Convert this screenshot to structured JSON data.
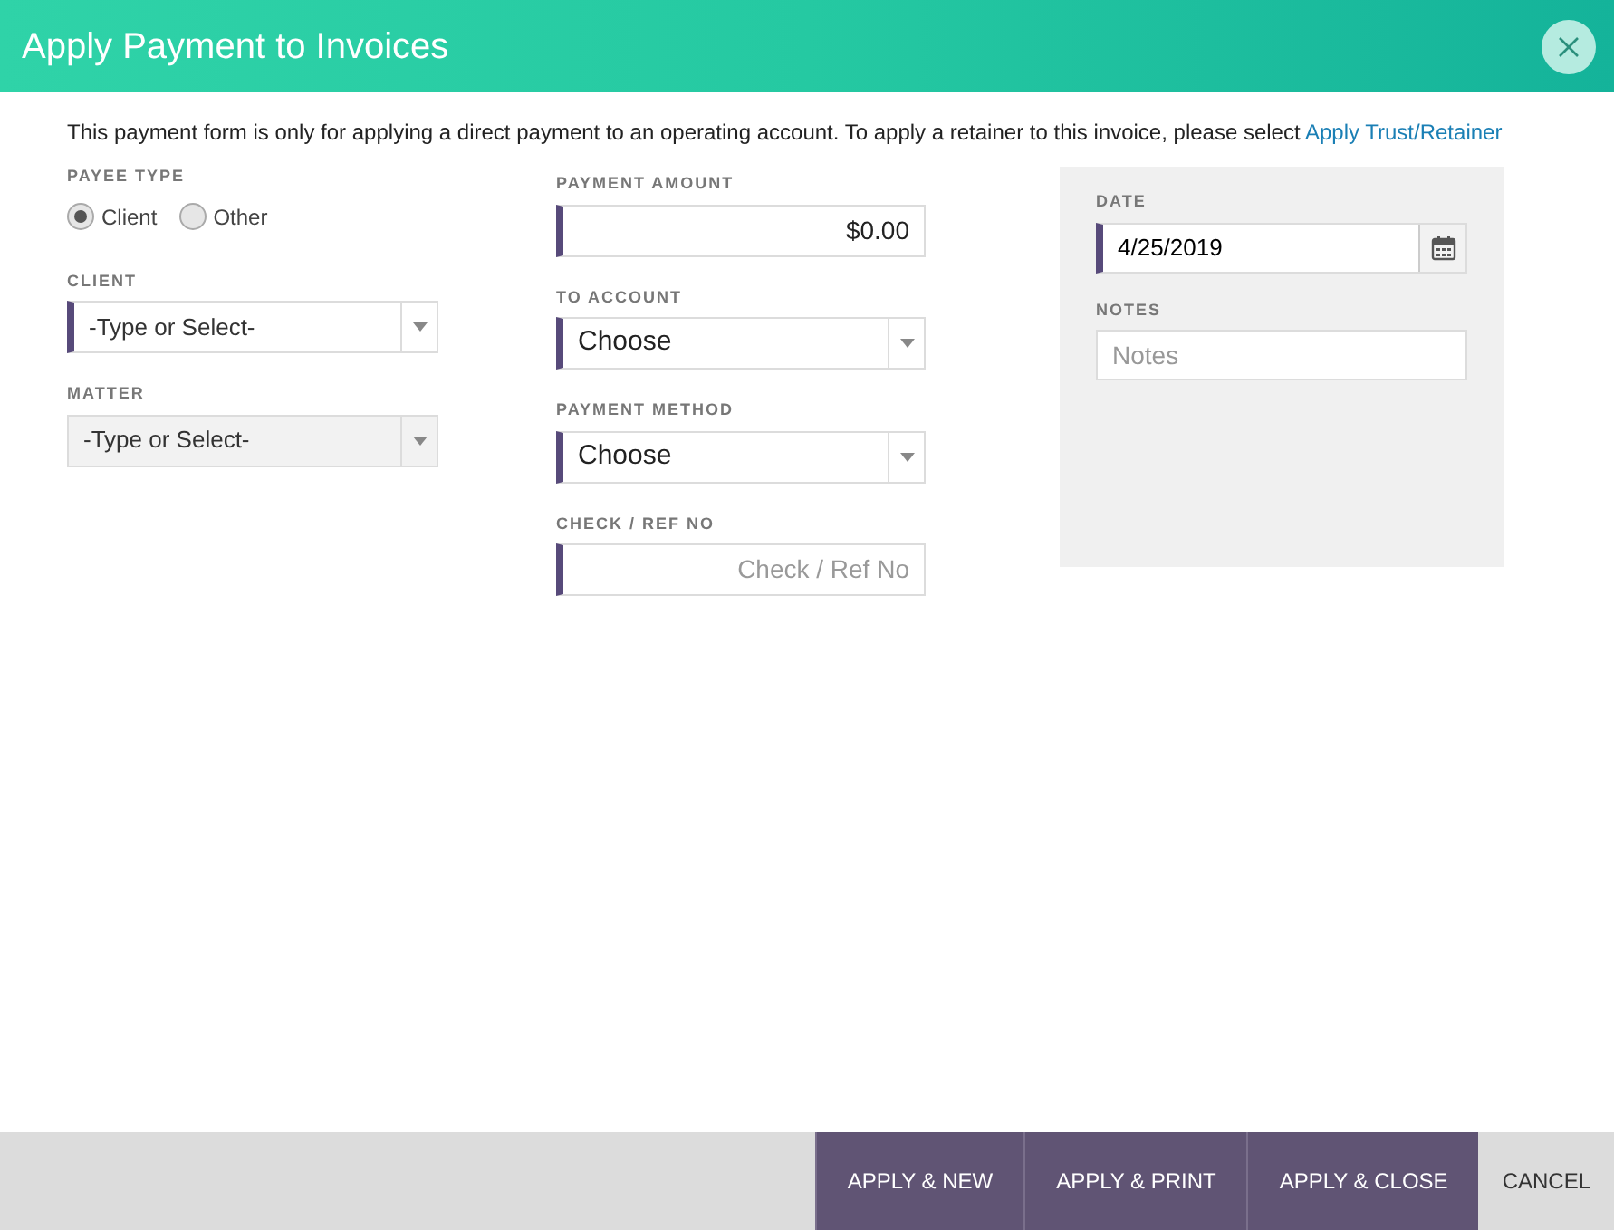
{
  "dialog": {
    "title": "Apply Payment to Invoices"
  },
  "notice": {
    "text": "This payment form is only for applying a direct payment to an operating account. To apply a retainer to this invoice, please select",
    "link": "Apply Trust/Retainer"
  },
  "payee_type": {
    "label": "PAYEE TYPE",
    "options": [
      {
        "label": "Client",
        "selected": true
      },
      {
        "label": "Other",
        "selected": false
      }
    ]
  },
  "left_fields": [
    {
      "label": "CLIENT",
      "kind": "select",
      "value": "-Type or Select-",
      "required": true,
      "disabled": false
    },
    {
      "label": "MATTER",
      "kind": "select",
      "value": "-Type or Select-",
      "required": false,
      "disabled": true
    }
  ],
  "middle_fields": [
    {
      "label": "PAYMENT AMOUNT",
      "kind": "amount",
      "value": "$0.00",
      "required": true,
      "disabled": false
    },
    {
      "label": "TO ACCOUNT",
      "kind": "select",
      "value": "Choose",
      "required": true,
      "disabled": false
    },
    {
      "label": "PAYMENT METHOD",
      "kind": "select",
      "value": "Choose",
      "required": true,
      "disabled": false
    },
    {
      "label": "CHECK / REF NO",
      "kind": "amount",
      "placeholder": "Check / Ref No",
      "required": true,
      "disabled": false
    }
  ],
  "side_fields": [
    {
      "label": "DATE",
      "kind": "date",
      "value": "4/25/2019",
      "required": true,
      "disabled": false
    },
    {
      "label": "NOTES",
      "kind": "text",
      "placeholder": "Notes",
      "required": false,
      "disabled": false
    }
  ],
  "buttons": [
    {
      "label": "APPLY & NEW",
      "kind": "primary"
    },
    {
      "label": "APPLY & PRINT",
      "kind": "primary"
    },
    {
      "label": "APPLY & CLOSE",
      "kind": "primary"
    },
    {
      "label": "CANCEL",
      "kind": "plain"
    }
  ]
}
